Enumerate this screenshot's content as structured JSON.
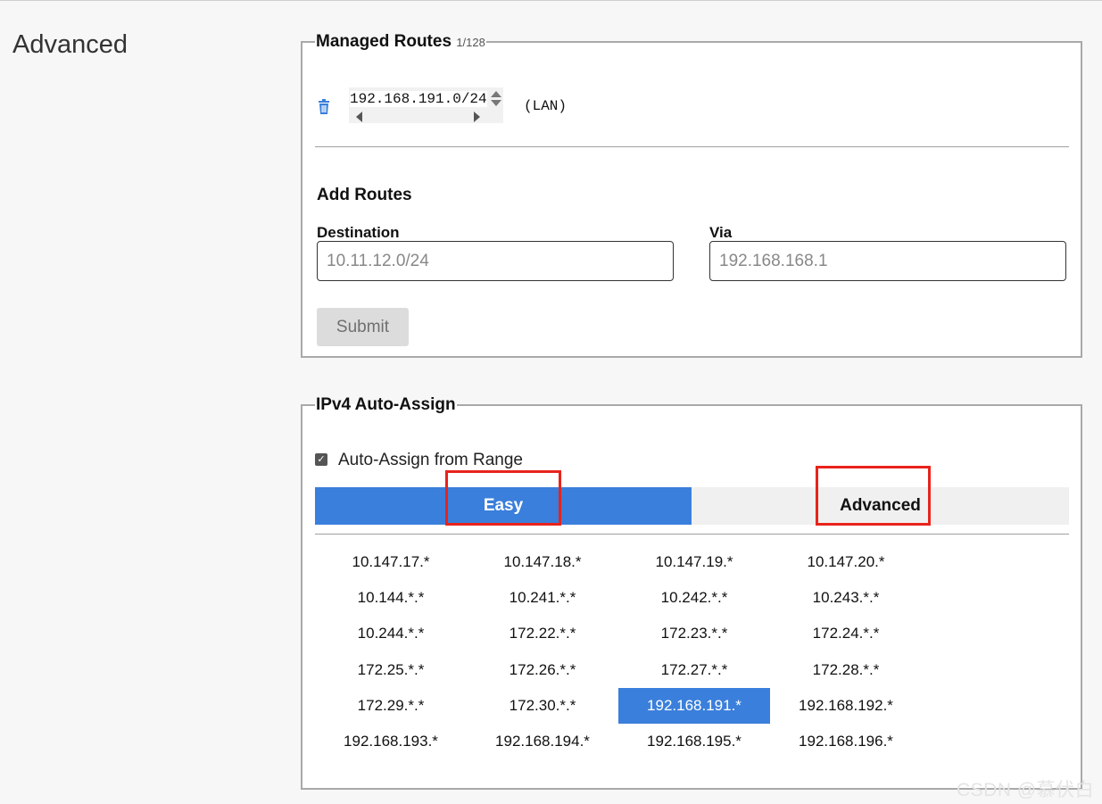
{
  "section": {
    "title": "Advanced"
  },
  "managed_routes": {
    "legend": "Managed Routes",
    "count": "1/128",
    "routes": [
      {
        "target": "192.168.191.0/24",
        "via": "(LAN)"
      }
    ],
    "add": {
      "title": "Add Routes",
      "destination_label": "Destination",
      "destination_placeholder": "10.11.12.0/24",
      "via_label": "Via",
      "via_placeholder": "192.168.168.1",
      "submit_label": "Submit"
    }
  },
  "ipv4": {
    "legend": "IPv4 Auto-Assign",
    "checkbox_label": "Auto-Assign from Range",
    "checkbox_checked": true,
    "tabs": {
      "easy": "Easy",
      "advanced": "Advanced"
    },
    "active_tab": "Easy",
    "ranges": [
      [
        "10.147.17.*",
        "10.147.18.*",
        "10.147.19.*",
        "10.147.20.*"
      ],
      [
        "10.144.*.*",
        "10.241.*.*",
        "10.242.*.*",
        "10.243.*.*"
      ],
      [
        "10.244.*.*",
        "172.22.*.*",
        "172.23.*.*",
        "172.24.*.*"
      ],
      [
        "172.25.*.*",
        "172.26.*.*",
        "172.27.*.*",
        "172.28.*.*"
      ],
      [
        "172.29.*.*",
        "172.30.*.*",
        "192.168.191.*",
        "192.168.192.*"
      ],
      [
        "192.168.193.*",
        "192.168.194.*",
        "192.168.195.*",
        "192.168.196.*"
      ]
    ],
    "selected_range": "192.168.191.*"
  },
  "colors": {
    "accent": "#3a7fdb",
    "highlight": "#e8231c"
  },
  "watermark": "CSDN @慕伏白"
}
